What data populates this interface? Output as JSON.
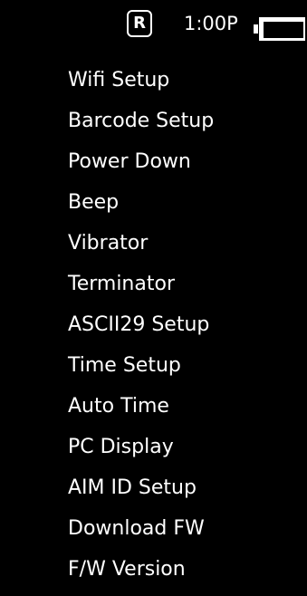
{
  "status_bar": {
    "mode_badge": "R",
    "time": "1:00P",
    "battery_icon": "battery-full-icon"
  },
  "menu": {
    "items": [
      {
        "label": "Wifi Setup"
      },
      {
        "label": "Barcode Setup"
      },
      {
        "label": "Power Down"
      },
      {
        "label": "Beep"
      },
      {
        "label": "Vibrator"
      },
      {
        "label": "Terminator"
      },
      {
        "label": "ASCII29 Setup"
      },
      {
        "label": "Time Setup"
      },
      {
        "label": "Auto Time"
      },
      {
        "label": "PC Display"
      },
      {
        "label": "AIM ID Setup"
      },
      {
        "label": "Download FW"
      },
      {
        "label": "F/W Version"
      }
    ]
  },
  "colors": {
    "background": "#000000",
    "text": "#ffffff"
  }
}
